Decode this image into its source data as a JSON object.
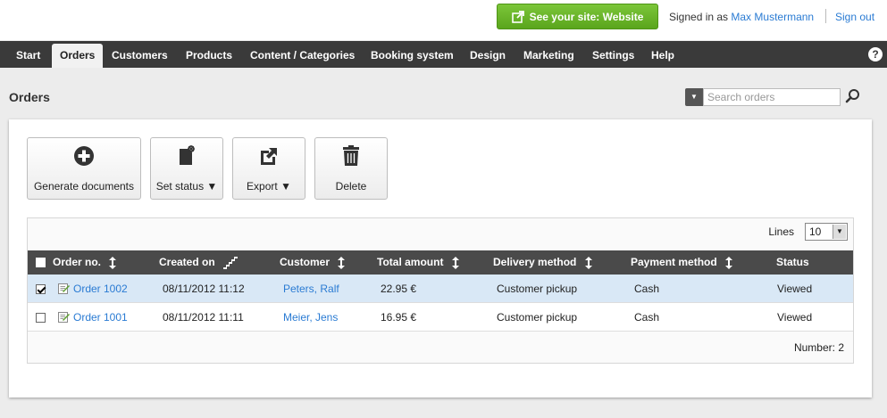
{
  "header": {
    "site_button": "See your site: Website",
    "signed_in_prefix": "Signed in as",
    "user_name": "Max Mustermann",
    "sign_out": "Sign out"
  },
  "nav": {
    "items": [
      "Start",
      "Orders",
      "Customers",
      "Products",
      "Content / Categories",
      "Booking system",
      "Design",
      "Marketing",
      "Settings",
      "Help"
    ],
    "active": "Orders",
    "help_icon": "?"
  },
  "page": {
    "title": "Orders",
    "search_placeholder": "Search orders"
  },
  "toolbar": {
    "generate": "Generate documents",
    "set_status": "Set status ▼",
    "export": "Export ▼",
    "delete": "Delete"
  },
  "grid": {
    "lines_label": "Lines",
    "lines_value": "10",
    "columns": [
      "Order no.",
      "Created on",
      "Customer",
      "Total amount",
      "Delivery method",
      "Payment method",
      "Status"
    ],
    "rows": [
      {
        "checked": true,
        "order": "Order 1002",
        "created": "08/11/2012 11:12",
        "customer": "Peters, Ralf",
        "total": "22.95 €",
        "delivery": "Customer pickup",
        "payment": "Cash",
        "status": "Viewed"
      },
      {
        "checked": false,
        "order": "Order 1001",
        "created": "08/11/2012 11:11",
        "customer": "Meier, Jens",
        "total": "16.95 €",
        "delivery": "Customer pickup",
        "payment": "Cash",
        "status": "Viewed"
      }
    ],
    "count_label": "Number: 2"
  },
  "colors": {
    "accent_green": "#6ab72a",
    "nav_bg": "#3a3a3a",
    "link": "#2a7bd3",
    "selected_row": "#d9e8f6"
  }
}
